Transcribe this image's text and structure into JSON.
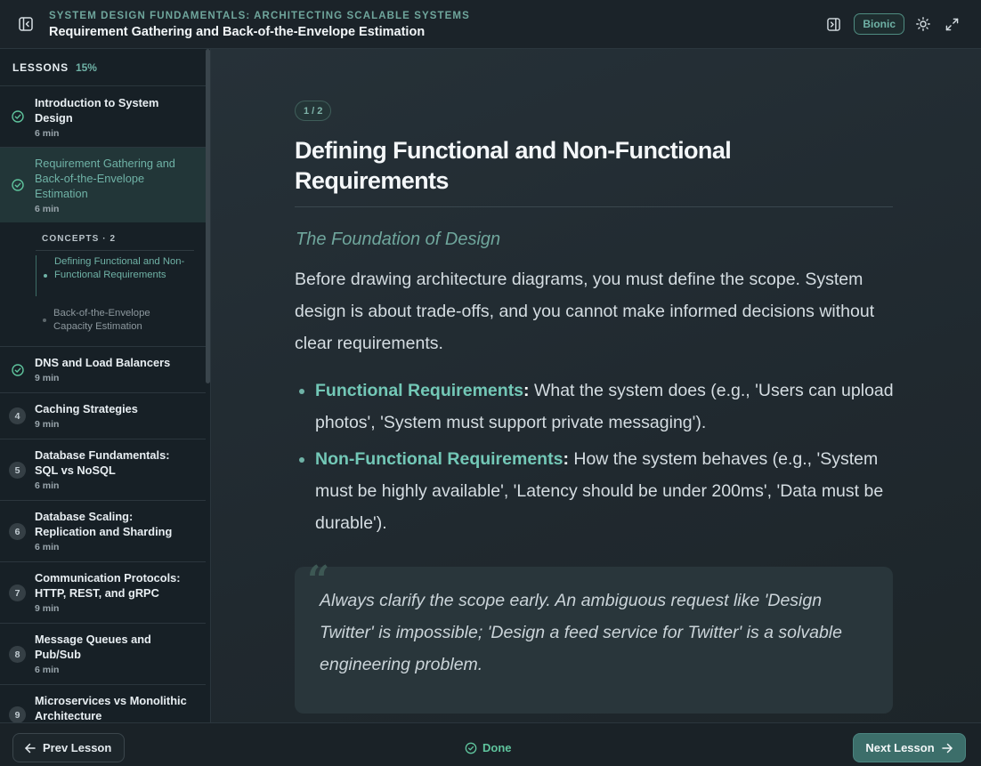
{
  "header": {
    "course_title": "SYSTEM DESIGN FUNDAMENTALS: ARCHITECTING SCALABLE SYSTEMS",
    "lesson_title": "Requirement Gathering and Back-of-the-Envelope Estimation",
    "bionic_label": "Bionic",
    "icons": [
      "sidebar-collapse-icon",
      "panel-toggle-icon",
      "sun-icon",
      "expand-icon"
    ]
  },
  "sidebar": {
    "heading": "LESSONS",
    "progress": "15%",
    "lessons": [
      {
        "title": "Introduction to System Design",
        "duration": "6 min",
        "status": "done"
      },
      {
        "title": "Requirement Gathering and Back-of-the-Envelope Estimation",
        "duration": "6 min",
        "status": "done-active"
      },
      {
        "title": "DNS and Load Balancers",
        "duration": "9 min",
        "status": "done"
      },
      {
        "number": "4",
        "title": "Caching Strategies",
        "duration": "9 min"
      },
      {
        "number": "5",
        "title": "Database Fundamentals: SQL vs NoSQL",
        "duration": "6 min"
      },
      {
        "number": "6",
        "title": "Database Scaling: Replication and Sharding",
        "duration": "6 min"
      },
      {
        "number": "7",
        "title": "Communication Protocols: HTTP, REST, and gRPC",
        "duration": "9 min"
      },
      {
        "number": "8",
        "title": "Message Queues and Pub/Sub",
        "duration": "6 min"
      },
      {
        "number": "9",
        "title": "Microservices vs Monolithic Architecture",
        "duration": ""
      }
    ],
    "concepts": {
      "heading": "CONCEPTS · 2",
      "items": [
        {
          "label": "Defining Functional and Non-Functional Requirements",
          "active": true
        },
        {
          "label": "Back-of-the-Envelope Capacity Estimation",
          "active": false
        }
      ]
    }
  },
  "main": {
    "pager": "1 / 2",
    "title": "Defining Functional and Non-Functional Requirements",
    "subheading": "The Foundation of Design",
    "intro": "Before drawing architecture diagrams, you must define the scope. System design is about trade-offs, and you cannot make informed decisions without clear requirements.",
    "bullets": [
      {
        "term": "Functional Requirements",
        "text": "What the system does (e.g., 'Users can upload photos', 'System must support private messaging')."
      },
      {
        "term": "Non-Functional Requirements",
        "text": "How the system behaves (e.g., 'System must be highly available', 'Latency should be under 200ms', 'Data must be durable')."
      }
    ],
    "quote": "Always clarify the scope early. An ambiguous request like 'Design Twitter' is impossible; 'Design a feed service for Twitter' is a solvable engineering problem."
  },
  "footer": {
    "prev_label": "Prev Lesson",
    "done_label": "Done",
    "next_label": "Next Lesson"
  },
  "colors": {
    "accent": "#6fb2a6",
    "done_green": "#5fc49d",
    "background": "#1e262c"
  }
}
